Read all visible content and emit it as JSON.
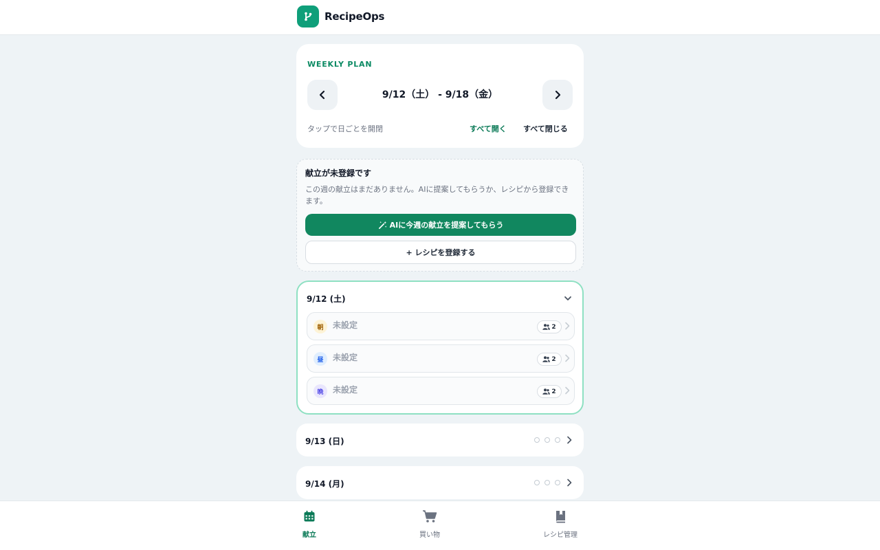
{
  "header": {
    "app_name": "RecipeOps",
    "logo_icon": "branch-icon"
  },
  "week": {
    "eyebrow": "WEEKLY PLAN",
    "range": "9/12（土） - 9/18（金）",
    "hint": "タップで日ごとを開閉",
    "expand_all": "すべて開く",
    "collapse_all": "すべて閉じる"
  },
  "empty": {
    "title": "献立が未登録です",
    "description": "この週の献立はまだありません。AIに提案してもらうか、レシピから登録できます。",
    "ai_button": "AIに今週の献立を提案してもらう",
    "register_button": "+ レシピを登録する"
  },
  "days": [
    {
      "label": "9/12 (土)",
      "expanded": true,
      "meals": [
        {
          "badge": "朝",
          "name": "未設定",
          "servings": "2",
          "badge_bg": "#fdf3d6",
          "badge_fg": "#a16207"
        },
        {
          "badge": "昼",
          "name": "未設定",
          "servings": "2",
          "badge_bg": "#e0eefe",
          "badge_fg": "#2563eb"
        },
        {
          "badge": "晩",
          "name": "未設定",
          "servings": "2",
          "badge_bg": "#e9e6fd",
          "badge_fg": "#4f46e5"
        }
      ]
    },
    {
      "label": "9/13 (日)",
      "expanded": false
    },
    {
      "label": "9/14 (月)",
      "expanded": false
    }
  ],
  "nav": [
    {
      "label": "献立",
      "icon": "calendar-icon",
      "active": true
    },
    {
      "label": "買い物",
      "icon": "cart-icon",
      "active": false
    },
    {
      "label": "レシピ管理",
      "icon": "book-icon",
      "active": false
    }
  ],
  "colors": {
    "accent": "#11875f",
    "accent_text": "#0b7a57",
    "background": "#eef3f6"
  }
}
